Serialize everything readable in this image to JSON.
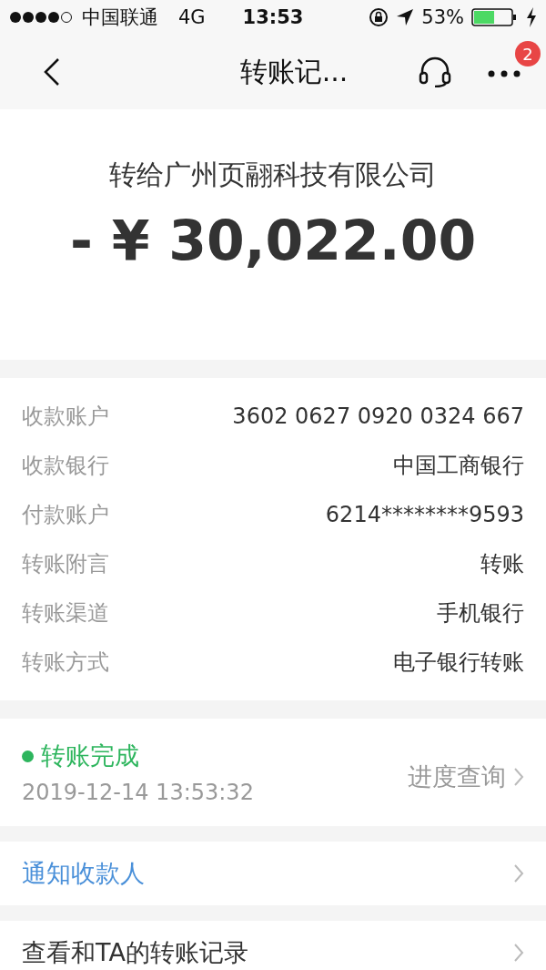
{
  "status_bar": {
    "carrier": "中国联通",
    "network": "4G",
    "time": "13:53",
    "battery": "53%"
  },
  "nav": {
    "title": "转账记...",
    "badge": "2"
  },
  "summary": {
    "payee": "转给广州页翮科技有限公司",
    "amount": "- ¥ 30,022.00"
  },
  "details": [
    {
      "label": "收款账户",
      "value": "3602 0627 0920 0324 667"
    },
    {
      "label": "收款银行",
      "value": "中国工商银行"
    },
    {
      "label": "付款账户",
      "value": "6214********9593"
    },
    {
      "label": "转账附言",
      "value": "转账"
    },
    {
      "label": "转账渠道",
      "value": "手机银行"
    },
    {
      "label": "转账方式",
      "value": "电子银行转账"
    }
  ],
  "progress": {
    "status": "转账完成",
    "time": "2019-12-14 13:53:32",
    "link": "进度查询"
  },
  "actions": [
    {
      "label": "通知收款人",
      "kind": "link"
    },
    {
      "label": "查看和TA的转账记录",
      "kind": "plain"
    }
  ]
}
